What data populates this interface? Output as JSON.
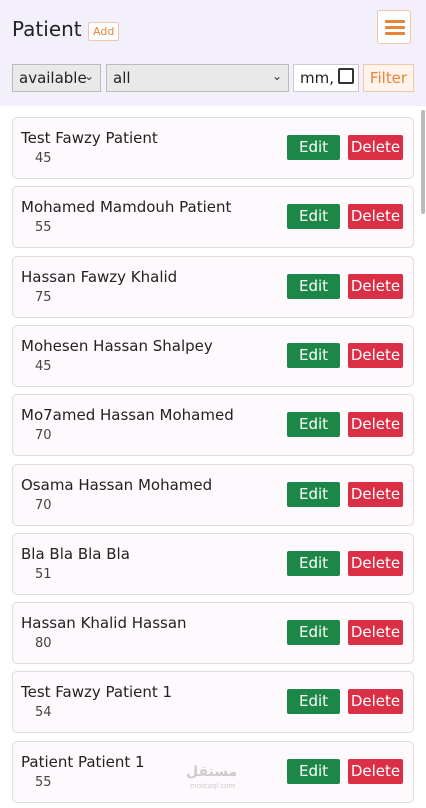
{
  "header": {
    "title": "Patient",
    "add_label": "Add",
    "menu_icon": "hamburger-icon"
  },
  "filters": {
    "status_value": "available",
    "category_value": "all",
    "date_placeholder": "mm,",
    "filter_label": "Filter"
  },
  "patients": [
    {
      "name": "Test Fawzy Patient",
      "age": "45",
      "edit": "Edit",
      "delete": "Delete"
    },
    {
      "name": "Mohamed Mamdouh Patient",
      "age": "55",
      "edit": "Edit",
      "delete": "Delete"
    },
    {
      "name": "Hassan Fawzy Khalid",
      "age": "75",
      "edit": "Edit",
      "delete": "Delete"
    },
    {
      "name": "Mohesen Hassan Shalpey",
      "age": "45",
      "edit": "Edit",
      "delete": "Delete"
    },
    {
      "name": "Mo7amed Hassan Mohamed",
      "age": "70",
      "edit": "Edit",
      "delete": "Delete"
    },
    {
      "name": "Osama Hassan Mohamed",
      "age": "70",
      "edit": "Edit",
      "delete": "Delete"
    },
    {
      "name": "Bla Bla Bla Bla",
      "age": "51",
      "edit": "Edit",
      "delete": "Delete"
    },
    {
      "name": "Hassan Khalid Hassan",
      "age": "80",
      "edit": "Edit",
      "delete": "Delete"
    },
    {
      "name": "Test Fawzy Patient 1",
      "age": "54",
      "edit": "Edit",
      "delete": "Delete"
    },
    {
      "name": "Patient Patient 1",
      "age": "55",
      "edit": "Edit",
      "delete": "Delete"
    }
  ],
  "watermark": {
    "text": "مستقل",
    "sub": "mostaql.com"
  },
  "colors": {
    "accent": "#e8843a",
    "edit": "#1c8747",
    "delete": "#db2f45",
    "header_bg": "#f3f0fc"
  }
}
